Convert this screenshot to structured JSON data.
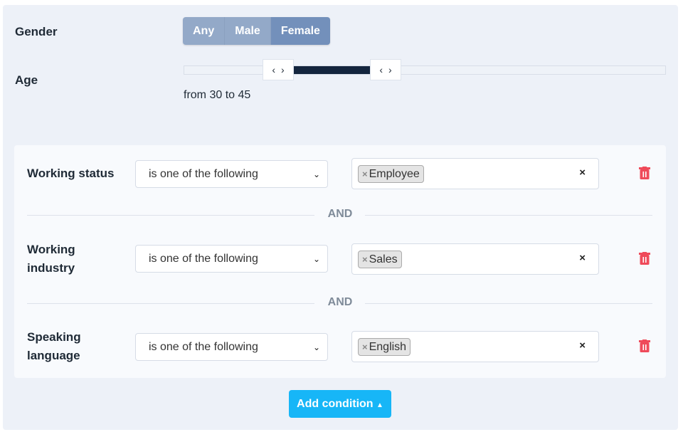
{
  "gender": {
    "label": "Gender",
    "options": [
      "Any",
      "Male",
      "Female"
    ],
    "selected": "Female"
  },
  "age": {
    "label": "Age",
    "from": 30,
    "to": 45,
    "range_text": "from 30 to 45"
  },
  "conditions": [
    {
      "label": "Working status",
      "operator": "is one of the following",
      "tags": [
        "Employee"
      ]
    },
    {
      "label": "Working industry",
      "operator": "is one of the following",
      "tags": [
        "Sales"
      ]
    },
    {
      "label": "Speaking language",
      "operator": "is one of the following",
      "tags": [
        "English"
      ]
    }
  ],
  "connector": "AND",
  "add_condition_label": "Add condition",
  "colors": {
    "accent": "#17b6f7",
    "danger": "#ef4a5a",
    "slider_fill": "#13253e",
    "segment_active": "#7390bb"
  }
}
